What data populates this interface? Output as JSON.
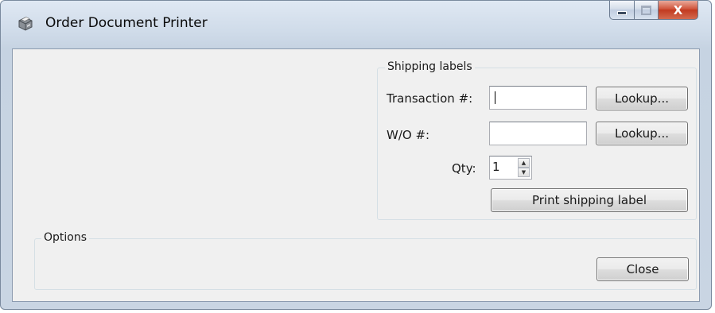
{
  "window": {
    "title": "Order Document Printer",
    "controls": {
      "minimize_icon": "minimize-icon",
      "maximize_icon": "maximize-icon",
      "close_label": "X"
    }
  },
  "shipping_labels": {
    "group_title": "Shipping labels",
    "transaction": {
      "label": "Transaction #:",
      "value": "",
      "lookup_button": "Lookup..."
    },
    "wo": {
      "label": "W/O #:",
      "value": "",
      "lookup_button": "Lookup..."
    },
    "qty": {
      "label": "Qty:",
      "value": "1"
    },
    "print_button": "Print shipping label"
  },
  "options": {
    "group_title": "Options",
    "close_button": "Close"
  },
  "colors": {
    "client_bg": "#f0f0f0",
    "titlebar_bg": "#cfdbe9",
    "close_button_bg": "#c13a20"
  }
}
